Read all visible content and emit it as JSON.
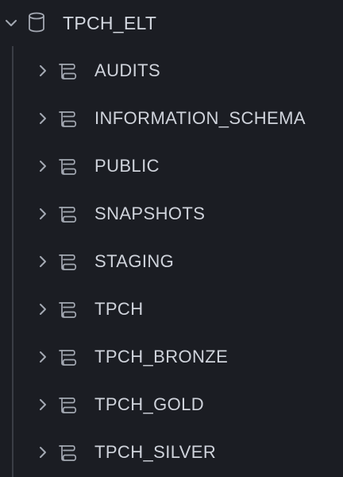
{
  "database": {
    "name": "TPCH_ELT",
    "expanded": true,
    "icon": "database-icon",
    "chevron_icon": "chevron-down-icon"
  },
  "schemas": [
    {
      "label": "AUDITS",
      "icon": "schema-icon",
      "chevron_icon": "chevron-right-icon"
    },
    {
      "label": "INFORMATION_SCHEMA",
      "icon": "schema-icon",
      "chevron_icon": "chevron-right-icon"
    },
    {
      "label": "PUBLIC",
      "icon": "schema-icon",
      "chevron_icon": "chevron-right-icon"
    },
    {
      "label": "SNAPSHOTS",
      "icon": "schema-icon",
      "chevron_icon": "chevron-right-icon"
    },
    {
      "label": "STAGING",
      "icon": "schema-icon",
      "chevron_icon": "chevron-right-icon"
    },
    {
      "label": "TPCH",
      "icon": "schema-icon",
      "chevron_icon": "chevron-right-icon"
    },
    {
      "label": "TPCH_BRONZE",
      "icon": "schema-icon",
      "chevron_icon": "chevron-right-icon"
    },
    {
      "label": "TPCH_GOLD",
      "icon": "schema-icon",
      "chevron_icon": "chevron-right-icon"
    },
    {
      "label": "TPCH_SILVER",
      "icon": "schema-icon",
      "chevron_icon": "chevron-right-icon"
    }
  ],
  "colors": {
    "background": "#1b1d23",
    "text": "#cfd3db",
    "icon": "#a4a9b3",
    "guide_line": "#3a3d45"
  }
}
